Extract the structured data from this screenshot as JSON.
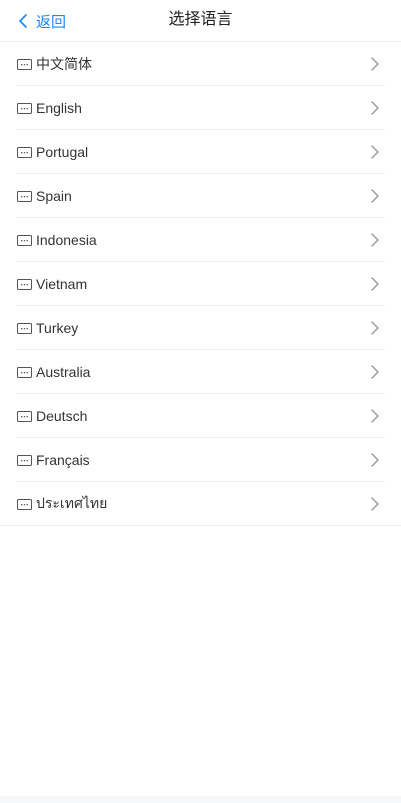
{
  "header": {
    "back_label": "返回",
    "title": "选择语言",
    "accent_color": "#1989fa"
  },
  "languages": [
    {
      "label": "中文简体",
      "icon": "keyboard-icon"
    },
    {
      "label": "English",
      "icon": "keyboard-icon"
    },
    {
      "label": "Portugal",
      "icon": "keyboard-icon"
    },
    {
      "label": "Spain",
      "icon": "keyboard-icon"
    },
    {
      "label": "Indonesia",
      "icon": "keyboard-icon"
    },
    {
      "label": "Vietnam",
      "icon": "keyboard-icon"
    },
    {
      "label": "Turkey",
      "icon": "keyboard-icon"
    },
    {
      "label": "Australia",
      "icon": "keyboard-icon"
    },
    {
      "label": "Deutsch",
      "icon": "keyboard-icon"
    },
    {
      "label": "Français",
      "icon": "keyboard-icon"
    },
    {
      "label": "ประเทศไทย",
      "icon": "keyboard-icon"
    }
  ]
}
